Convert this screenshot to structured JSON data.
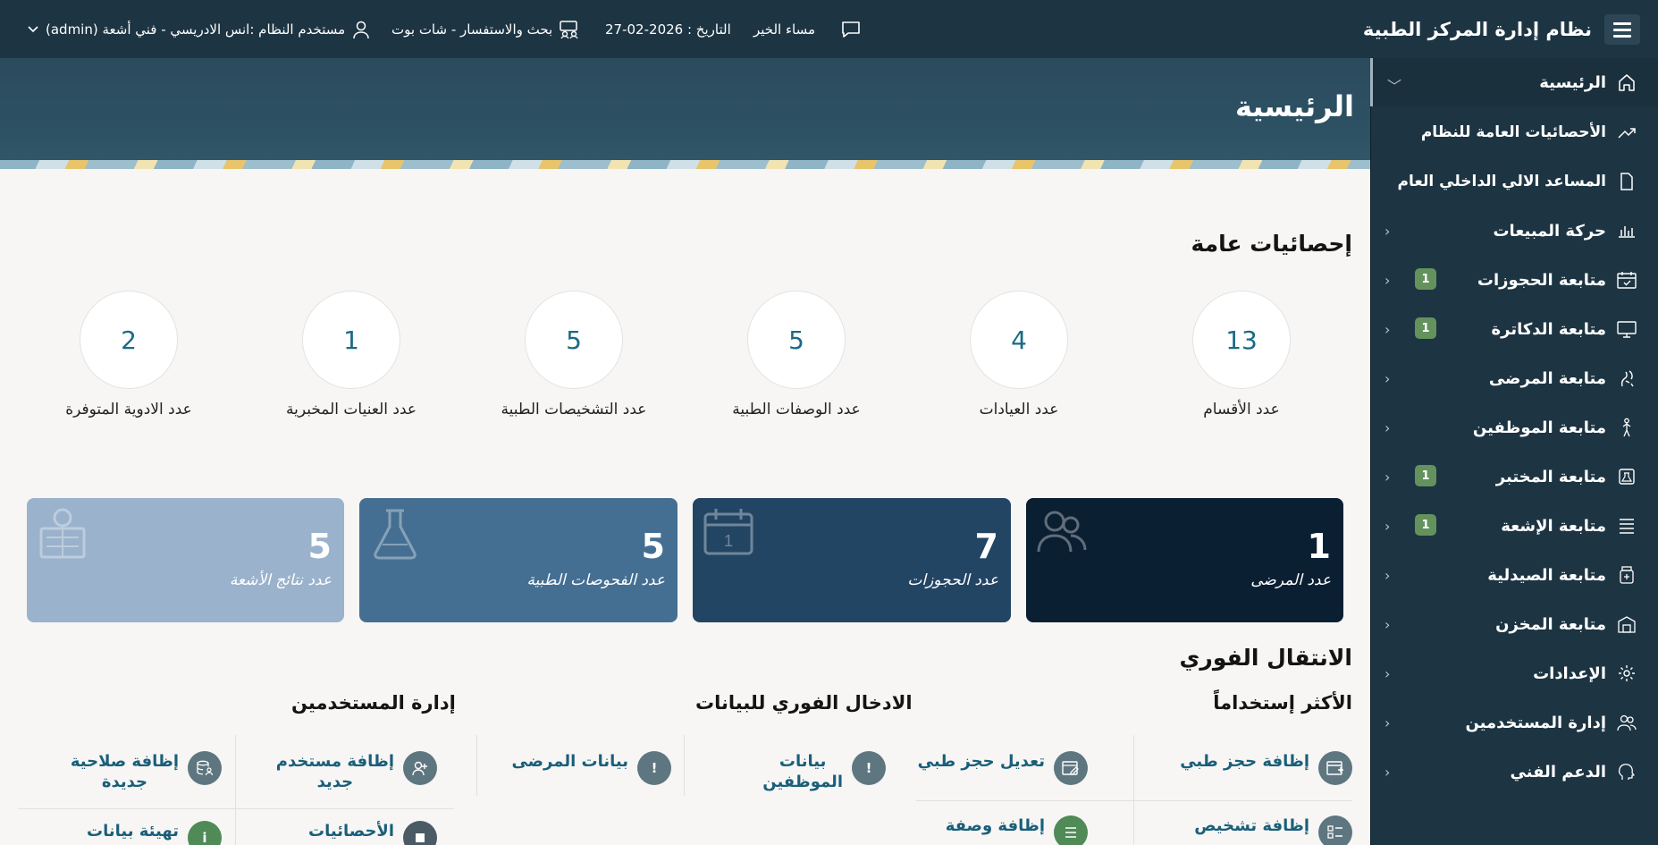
{
  "header": {
    "app_title": "نظام إدارة المركز الطبية",
    "greeting": "مساء الخير",
    "date": "التاريخ : 2026-02-27",
    "chatbot": "بحث والاستفسار - شات بوت",
    "user": "مستخدم النظام :انس الادريسي - فني أشعة (admin)"
  },
  "sidebar": {
    "items": [
      {
        "label": "الرئيسية",
        "icon": "home-icon",
        "badge": ""
      },
      {
        "label": "الأحصائيات العامة للنظام",
        "icon": "trend-icon",
        "badge": ""
      },
      {
        "label": "المساعد الالي الداخلي العام",
        "icon": "document-icon",
        "badge": ""
      },
      {
        "label": "حركة المبيعات",
        "icon": "bar-chart-icon",
        "badge": ""
      },
      {
        "label": "متابعة الحجوزات",
        "icon": "calendar-check-icon",
        "badge": "1"
      },
      {
        "label": "متابعة الدكاترة",
        "icon": "monitor-icon",
        "badge": "1"
      },
      {
        "label": "متابعة المرضى",
        "icon": "patient-icon",
        "badge": ""
      },
      {
        "label": "متابعة الموظفين",
        "icon": "person-icon",
        "badge": ""
      },
      {
        "label": "متابعة المختبر",
        "icon": "lab-icon",
        "badge": "1"
      },
      {
        "label": "متابعة الإشعة",
        "icon": "list-icon",
        "badge": "1"
      },
      {
        "label": "متابعة الصيدلية",
        "icon": "medicine-icon",
        "badge": ""
      },
      {
        "label": "متابعة المخزن",
        "icon": "warehouse-icon",
        "badge": ""
      },
      {
        "label": "الإعدادات",
        "icon": "gear-icon",
        "badge": ""
      },
      {
        "label": "إدارة المستخدمين",
        "icon": "users-icon",
        "badge": ""
      },
      {
        "label": "الدعم الفني",
        "icon": "support-icon",
        "badge": ""
      }
    ]
  },
  "main": {
    "page_title": "الرئيسية",
    "stats_title": "إحصائيات عامة",
    "stats": [
      {
        "value": "13",
        "label": "عدد الأقسام"
      },
      {
        "value": "4",
        "label": "عدد العيادات"
      },
      {
        "value": "5",
        "label": "عدد الوصفات الطبية"
      },
      {
        "value": "5",
        "label": "عدد التشخيصات الطبية"
      },
      {
        "value": "1",
        "label": "عدد العنيات المخبرية"
      },
      {
        "value": "2",
        "label": "عدد الادوية المتوفرة"
      }
    ],
    "cards": [
      {
        "value": "1",
        "label": "عدد المرضى",
        "color": "#0b1f33"
      },
      {
        "value": "7",
        "label": "عدد الحجوزات",
        "color": "#234564"
      },
      {
        "value": "5",
        "label": "عدد الفحوصات الطبية",
        "color": "#456f92"
      },
      {
        "value": "5",
        "label": "عدد نتائج الأشعة",
        "color": "#9ab2cb"
      }
    ],
    "quick_title": "الانتقال الفوري",
    "groups": {
      "most_used": "الأكثر إستخداماً",
      "quick_entry": "الادخال الفوري للبيانات",
      "users_admin": "إدارة المستخدمين"
    },
    "actions": {
      "add_booking": "إظافة حجز طبي",
      "edit_booking": "تعديل حجز طبي",
      "add_diagnosis": "إظافة تشخيص",
      "add_prescription": "إظافة وصفة",
      "employees_data_1": "بيانات",
      "employees_data_2": "الموظفين",
      "patients_data": "بيانات المرضى",
      "add_user_1": "إظافة مستخدم",
      "add_user_2": "جديد",
      "add_permission_1": "إظافة صلاحية",
      "add_permission_2": "جديدة",
      "statistics": "الأحصائيات",
      "init_data": "تهيئة بيانات"
    }
  }
}
